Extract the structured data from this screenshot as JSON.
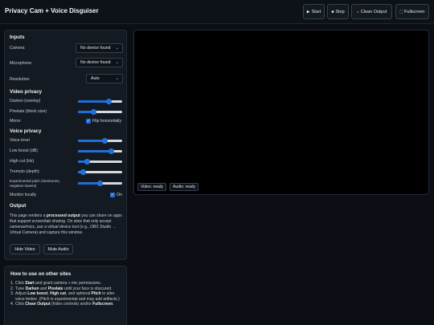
{
  "header": {
    "title": "Privacy Cam + Voice Disguiser",
    "buttons": {
      "start": "Start",
      "stop": "Stop",
      "clean_output": "Clean Output",
      "fullscreen": "Fullscreen"
    },
    "icons": {
      "start": "play-icon",
      "stop": "stop-icon",
      "clean_output": "paint-icon",
      "fullscreen": "fullscreen-icon"
    }
  },
  "inputs": {
    "title": "Inputs",
    "camera_label": "Camera",
    "camera_value": "No device found",
    "microphone_label": "Microphone",
    "microphone_value": "No device found",
    "resolution_label": "Resolution",
    "resolution_value": "Auto"
  },
  "video_privacy": {
    "title": "Video privacy",
    "darken_label": "Darken (overlay)",
    "darken_value": 0.7,
    "pixelate_label": "Pixelate (block size)",
    "pixelate_value": 0.35,
    "mirror_label": "Mirror",
    "mirror_checkbox_label": "Flip horizontally",
    "mirror_checked": true
  },
  "voice_privacy": {
    "title": "Voice privacy",
    "voice_level_label": "Voice level",
    "voice_level_value": 0.6,
    "low_boost_label": "Low boost (dB)",
    "low_boost_value": 0.75,
    "high_cut_label": "High cut (Hz)",
    "high_cut_value": 0.2,
    "tremolo_label": "Tremolo (depth)",
    "tremolo_value": 0.12,
    "pitch_label": "Experimental pitch (semitones, negative lowers)",
    "pitch_value": 0.5,
    "monitor_label": "Monitor locally",
    "monitor_checkbox_label": "On",
    "monitor_checked": true
  },
  "output": {
    "title": "Output",
    "text_1": "This page renders a ",
    "text_bold": "processed output",
    "text_2": " you can share on apps that support screen/tab sharing. On sites that only accept cameras/mics, use a virtual device tool (e.g., ",
    "text_italic": "OBS Studio → Virtual Camera",
    "text_3": ") and capture this window.",
    "hide_video_button": "Hide Video",
    "mute_audio_button": "Mute Audio"
  },
  "how_to": {
    "title": "How to use on other sites",
    "steps": [
      {
        "num": "1.",
        "parts": [
          [
            "Click ",
            false
          ],
          [
            "Start",
            true
          ],
          [
            " and grant camera + mic permissions.",
            false
          ]
        ]
      },
      {
        "num": "2.",
        "parts": [
          [
            "Tune ",
            false
          ],
          [
            "Darken",
            true
          ],
          [
            " and ",
            false
          ],
          [
            "Pixelate",
            true
          ],
          [
            " until your face is obscured.",
            false
          ]
        ]
      },
      {
        "num": "3.",
        "parts": [
          [
            "Adjust ",
            false
          ],
          [
            "Low boost",
            true
          ],
          [
            ", ",
            false
          ],
          [
            "High cut",
            true
          ],
          [
            ", and optional ",
            false
          ],
          [
            "Pitch",
            true
          ],
          [
            " to alter voice timbre. (Pitch is experimental and may add artifacts.)",
            false
          ]
        ]
      },
      {
        "num": "4.",
        "parts": [
          [
            "Click ",
            false
          ],
          [
            "Clean Output",
            true
          ],
          [
            " (hides controls) and/or ",
            false
          ],
          [
            "Fullscreen",
            true
          ],
          [
            ".",
            false
          ]
        ]
      }
    ]
  },
  "status": {
    "video": "Video: ready",
    "audio": "Audio: ready"
  },
  "colors": {
    "accent": "#1f6fd8",
    "background": "#0b0f15",
    "panel": "#141a21"
  }
}
